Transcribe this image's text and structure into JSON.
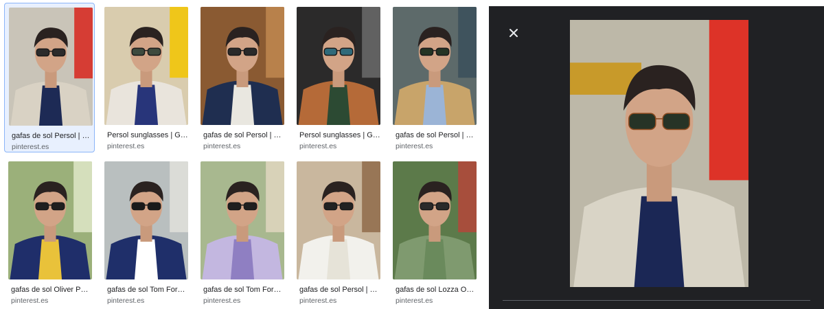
{
  "results": [
    {
      "title": "gafas de sol Persol | G…",
      "source": "pinterest.es",
      "bg": "#c9c4b8",
      "accent": "#d8261c",
      "jacket": "#d9d2c4",
      "shirt": "#1d2a55",
      "lens": "#2b2b2b"
    },
    {
      "title": "Persol sunglasses | Gaf…",
      "source": "pinterest.es",
      "bg": "#d9ccae",
      "accent": "#f2c400",
      "jacket": "#e9e4dc",
      "shirt": "#28357a",
      "lens": "#3e4a3e"
    },
    {
      "title": "gafas de sol Persol | G…",
      "source": "pinterest.es",
      "bg": "#8a5a32",
      "accent": "#c08850",
      "jacket": "#1f2e50",
      "shirt": "#e9e7e0",
      "lens": "#2a2a2a"
    },
    {
      "title": "Persol sunglasses | Gaf…",
      "source": "pinterest.es",
      "bg": "#2b2a2a",
      "accent": "#6b6b6b",
      "jacket": "#b56a38",
      "shirt": "#2c4a33",
      "lens": "#2f6a7a"
    },
    {
      "title": "gafas de sol Persol | G…",
      "source": "pinterest.es",
      "bg": "#5d6a6a",
      "accent": "#3a4f5a",
      "jacket": "#c8a46a",
      "shirt": "#9bb4d6",
      "lens": "#243424"
    },
    {
      "title": "gafas de sol Oliver Peo…",
      "source": "pinterest.es",
      "bg": "#9bb07a",
      "accent": "#dfe7c8",
      "jacket": "#1f2e6a",
      "shirt": "#e9c23a",
      "lens": "#1f1f1f"
    },
    {
      "title": "gafas de sol Tom Ford |…",
      "source": "pinterest.es",
      "bg": "#b9bfbf",
      "accent": "#e0e0da",
      "jacket": "#1f2f6a",
      "shirt": "#ffffff",
      "lens": "#1a1a1a"
    },
    {
      "title": "gafas de sol Tom Ford |…",
      "source": "pinterest.es",
      "bg": "#a8b88f",
      "accent": "#e1d6c0",
      "jacket": "#c3b7e0",
      "shirt": "#8f7fc2",
      "lens": "#1f1f1f"
    },
    {
      "title": "gafas de sol Persol | G…",
      "source": "pinterest.es",
      "bg": "#c9b79e",
      "accent": "#8f6b49",
      "jacket": "#f2f1ec",
      "shirt": "#e6e3d8",
      "lens": "#222222"
    },
    {
      "title": "gafas de sol Lozza Occ…",
      "source": "pinterest.es",
      "bg": "#5c7a4a",
      "accent": "#b4473a",
      "jacket": "#7f9a6f",
      "shirt": "#6a8a5c",
      "lens": "#2a2a2a"
    }
  ],
  "selected_index": 0,
  "viewer": {
    "close_icon": "close-icon",
    "preview": {
      "bg": "#bdb8a8",
      "accent": "#e31b12",
      "sign": "#c89a2a",
      "jacket": "#d9d4c6",
      "shirt": "#1b2755",
      "lens": "#263326",
      "frame": "#8b4a1f"
    }
  },
  "colors": {
    "selected_bg": "#e8f0fe",
    "selected_border": "#8ab4f8",
    "viewer_bg": "#202124",
    "title": "#202124",
    "source": "#5f6368"
  }
}
